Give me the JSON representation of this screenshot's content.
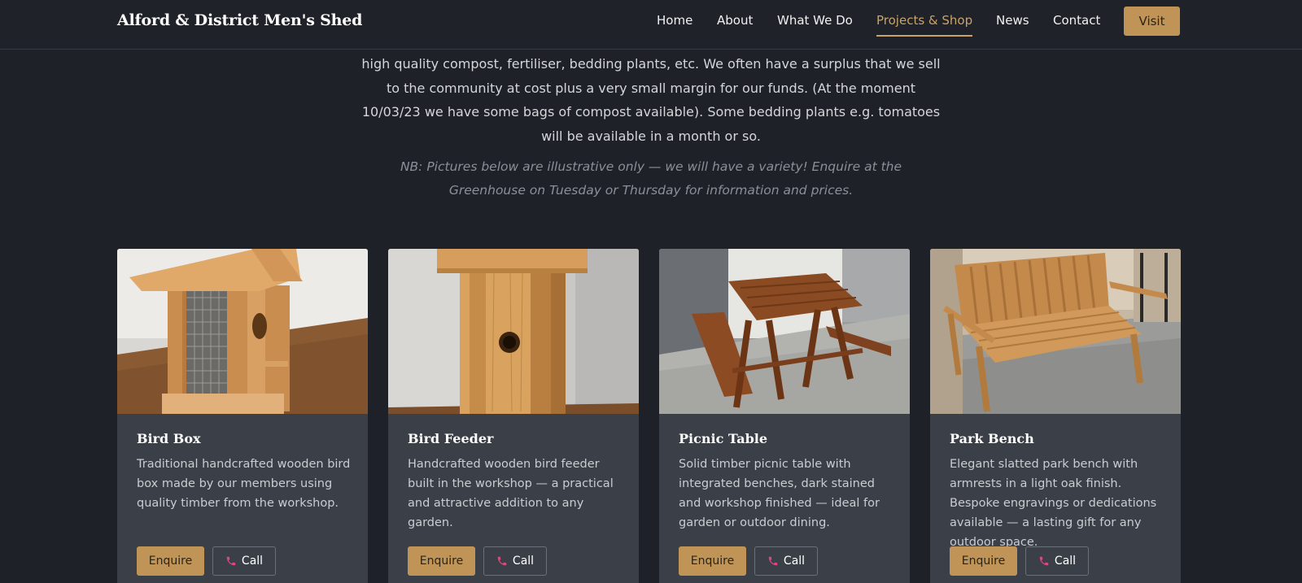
{
  "header": {
    "brand": "Alford & District Men's Shed",
    "nav": [
      "Home",
      "About",
      "What We Do",
      "Projects & Shop",
      "News",
      "Contact"
    ],
    "active_nav": "Projects & Shop",
    "visit_label": "Visit"
  },
  "intro": {
    "text": "high quality compost, fertiliser, bedding plants, etc. We often have a surplus that we sell to the community at cost plus a very small margin for our funds. (At the moment 10/03/23 we have some bags of compost available). Some bedding plants e.g. tomatoes will be available in a month or so.",
    "note": "NB: Pictures below are illustrative only — we will have a variety! Enquire at the Greenhouse on Tuesday or Thursday for information and prices."
  },
  "cards": [
    {
      "title": "Bird Box",
      "desc": "Traditional handcrafted wooden bird box made by our members using quality timber from the workshop.",
      "enquire": "Enquire",
      "call": "Call"
    },
    {
      "title": "Bird Feeder",
      "desc": "Handcrafted wooden bird feeder built in the workshop — a practical and attractive addition to any garden.",
      "enquire": "Enquire",
      "call": "Call"
    },
    {
      "title": "Picnic Table",
      "desc": "Solid timber picnic table with integrated benches, dark stained and workshop finished — ideal for garden or outdoor dining.",
      "enquire": "Enquire",
      "call": "Call"
    },
    {
      "title": "Park Bench",
      "desc": "Elegant slatted park bench with armrests in a light oak finish. Bespoke engravings or dedications available — a lasting gift for any outdoor space.",
      "enquire": "Enquire",
      "call": "Call"
    }
  ],
  "colors": {
    "background": "#1e2128",
    "accent": "#bf9456",
    "card": "#3b3f47",
    "phone_icon": "#e0457b"
  },
  "icons": {
    "call": "phone-icon"
  }
}
